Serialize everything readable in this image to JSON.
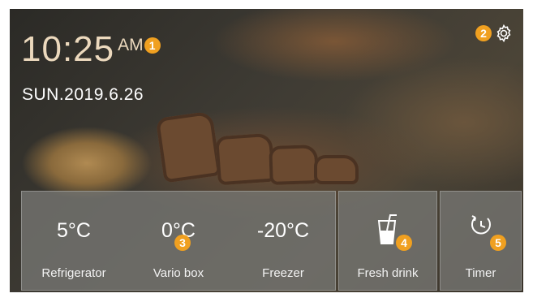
{
  "status": {
    "time": "10:25",
    "meridiem": "AM",
    "date": "SUN.2019.6.26"
  },
  "callouts": [
    "1",
    "2",
    "3",
    "4",
    "5"
  ],
  "zones": [
    {
      "temperature": "5°C",
      "label": "Refrigerator"
    },
    {
      "temperature": "0°C",
      "label": "Vario box"
    },
    {
      "temperature": "-20°C",
      "label": "Freezer"
    }
  ],
  "tiles": {
    "fresh_drink": {
      "label": "Fresh drink",
      "icon": "glass-with-straw-icon"
    },
    "timer": {
      "label": "Timer",
      "icon": "timer-icon"
    }
  },
  "settings": {
    "icon": "gear-icon"
  },
  "colors": {
    "callout": "#f0a020",
    "clock": "#ecd9bd",
    "panel": "#767672"
  }
}
